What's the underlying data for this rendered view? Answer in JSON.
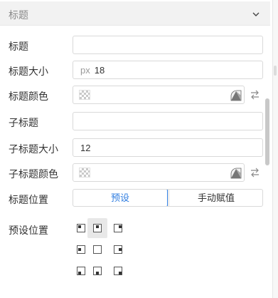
{
  "section": {
    "title": "标题",
    "collapse_icon": "chevron-down-icon"
  },
  "title": {
    "label": "标题",
    "value": ""
  },
  "title_size": {
    "label": "标题大小",
    "unit": "px",
    "value": "18"
  },
  "title_color": {
    "label": "标题颜色"
  },
  "subtitle": {
    "label": "子标题",
    "value": ""
  },
  "subtitle_size": {
    "label": "子标题大小",
    "value": "12"
  },
  "subtitle_color": {
    "label": "子标题颜色"
  },
  "title_position": {
    "label": "标题位置",
    "options": [
      "预设",
      "手动赋值"
    ],
    "selected": "预设"
  },
  "preset_position": {
    "label": "预设位置",
    "cells": [
      "top-left",
      "top-center",
      "top-right",
      "middle-left",
      "middle-center",
      "middle-right",
      "bottom-left",
      "bottom-center",
      "bottom-right"
    ],
    "selected": "top-center"
  },
  "colors": {
    "accent": "#2e7ce0",
    "header_bg": "#f2f2f2",
    "border": "#d9d9d9"
  }
}
